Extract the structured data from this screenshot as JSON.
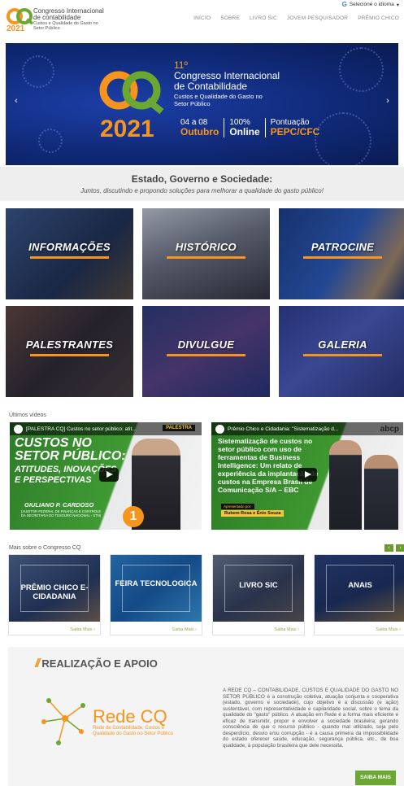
{
  "header": {
    "logo_lines": [
      "Congresso Internacional",
      "de contabilidade",
      "Custos e Qualidade do Gasto no Setor Público"
    ],
    "logo_year": "2021",
    "language_label": "Selecione o idioma",
    "nav": [
      "INÍCIO",
      "SOBRE",
      "LIVRO SIC",
      "JOVEM PESQUISADOR",
      "PRÊMIO CHICO"
    ]
  },
  "hero": {
    "logo_letters": "CQ",
    "logo_year": "2021",
    "ordinal": "11º",
    "title_lines": [
      "Congresso Internacional",
      "de Contabilidade"
    ],
    "subtitle_lines": [
      "Custos e Qualidade do Gasto no",
      "Setor Público"
    ],
    "date_top": "04 a 08",
    "date_bottom": "Outubro",
    "mode_top": "100%",
    "mode_bottom": "Online",
    "score_top": "Pontuação",
    "score_bottom": "PEPC/CFC"
  },
  "theme": {
    "title": "Estado, Governo e Sociedade:",
    "subtitle": "Juntos, discutindo e propondo soluções para melhorar a qualidade do gasto público!"
  },
  "tiles": [
    "INFORMAÇÕES",
    "HISTÓRICO",
    "PATROCINE",
    "PALESTRANTES",
    "DIVULGUE",
    "GALERIA"
  ],
  "videos": {
    "section_label": "Últimos vídeos",
    "v1": {
      "title": "[PALESTRA CQ] Custos no setor público: atit...",
      "tag": "PALESTRA",
      "headline_lines": [
        "CUSTOS NO",
        "SETOR PÚBLICO:"
      ],
      "sub_lines": [
        "ATITUDES, INOVAÇÕES",
        "E PERSPECTIVAS"
      ],
      "speaker": "GIULIANO P. CARDOSO",
      "speaker_role_lines": [
        "(AUDITOR FEDERAL DE FINANÇAS E CONTROLE",
        "DA SECRETARIA DO TESOURO NACIONAL - STN)"
      ],
      "number": "1"
    },
    "v2": {
      "title": "Prêmio Chico e Cidadania: \"Sistematização d...",
      "headline_lines": [
        "Sistematização de custos no",
        "setor público com uso de",
        "ferramentas de Business",
        "Intelligence: Um relato de",
        "experiência da implantação de",
        "custos na Empresa Brasil de",
        "Comunicação S/A – EBC"
      ],
      "presented_by": "Apresentado por:",
      "presenters": "Rubem Rosa e Ênio Souza",
      "brand": "abcp"
    }
  },
  "more": {
    "section_label": "Mais sobre o Congresso CQ",
    "prev": "‹",
    "next": "›",
    "cards": [
      {
        "label": "PRÊMIO CHICO E-CIDADANIA",
        "more": "Saiba Mais ›"
      },
      {
        "label": "FEIRA TECNOLOGICA",
        "more": "Saiba Mais ›"
      },
      {
        "label": "LIVRO SIC",
        "more": "Saiba Mais ›"
      },
      {
        "label": "ANAIS",
        "more": "Saiba Mais ›"
      }
    ]
  },
  "realizacao": {
    "title": "REALIZAÇÃO E APOIO",
    "rede_name": "Rede CQ",
    "rede_sub_lines": [
      "Rede de Contabilidade, Custos e",
      "Qualidade do Gasto no Setor Público"
    ],
    "paragraph": "A REDE CQ – CONTABILIDADE, CUSTOS E QUALIDADE DO GASTO NO SETOR PÚBLICO é a construção coletiva, atuação conjunta e cooperativa (estado, governo e sociedade), cujo objetivo é a discussão (e ação) sustentável, com representatividade e capilaridade social, sobre o tema da qualidade do \"gasto\" público. A atuação em Rede é a forma mais eficiente e eficaz de transmitir, propor e envolver a sociedade brasileira; gerando consciência de que o recurso público - quando mal utilizado, seja pelo desperdício, desvio e/ou corrupção - é a causa primeira da impossibilidade do estado oferecer saúde, educação, segurança pública, etc., de boa qualidade, à população brasileira que dele necessita.",
    "button": "SAIBA MAIS"
  },
  "colors": {
    "orange": "#f7941d",
    "green": "#6aa832",
    "hero_blue": "#102a78"
  }
}
